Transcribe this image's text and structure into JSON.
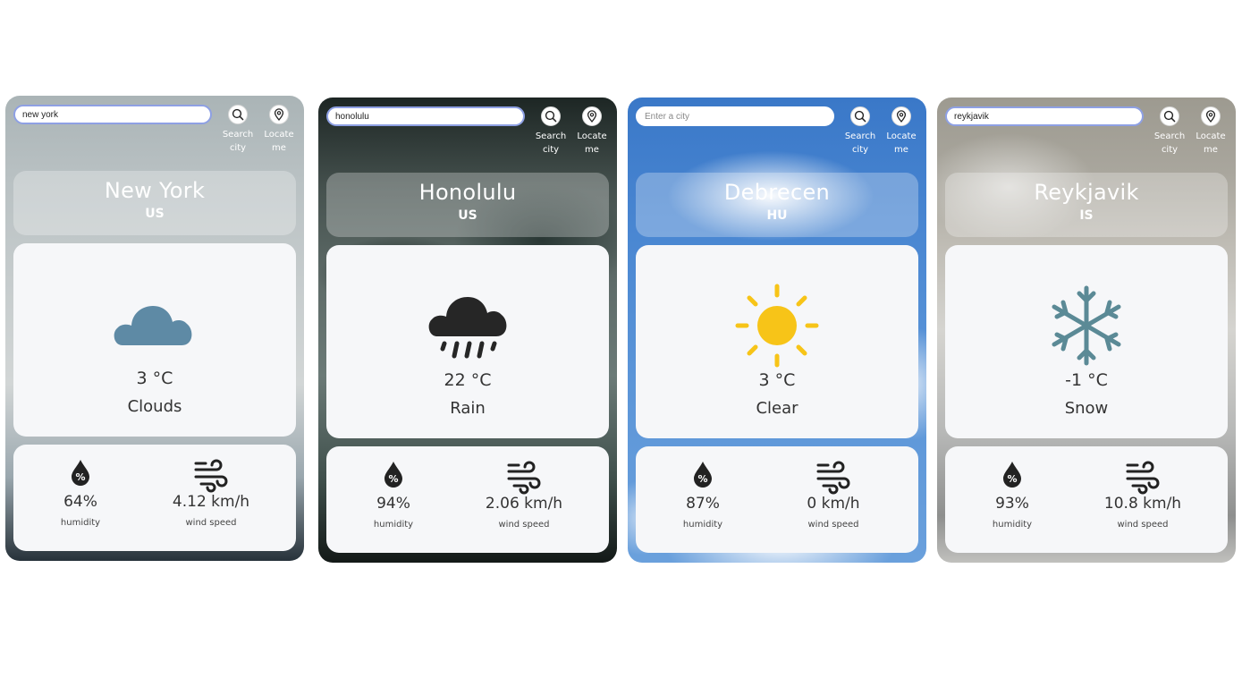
{
  "search_button_label": "Search city",
  "locate_button_label": "Locate me",
  "humidity_caption": "humidity",
  "wind_caption": "wind speed",
  "colors": {
    "cloud": "#5e8aa5",
    "rain": "#262626",
    "sun": "#f7c418",
    "snow": "#5b8a96",
    "input_border": "#8ea0e4"
  },
  "cards": [
    {
      "search_value": "new york",
      "search_placeholder": "",
      "city": "New York",
      "country": "US",
      "temperature": "3 °C",
      "condition": "Clouds",
      "icon": "cloud-icon",
      "humidity": "64%",
      "wind_speed": "4.12 km/h"
    },
    {
      "search_value": "honolulu",
      "search_placeholder": "",
      "city": "Honolulu",
      "country": "US",
      "temperature": "22 °C",
      "condition": "Rain",
      "icon": "rain-icon",
      "humidity": "94%",
      "wind_speed": "2.06 km/h"
    },
    {
      "search_value": "",
      "search_placeholder": "Enter a city",
      "city": "Debrecen",
      "country": "HU",
      "temperature": "3 °C",
      "condition": "Clear",
      "icon": "sun-icon",
      "humidity": "87%",
      "wind_speed": "0 km/h"
    },
    {
      "search_value": "reykjavik",
      "search_placeholder": "",
      "city": "Reykjavik",
      "country": "IS",
      "temperature": "-1 °C",
      "condition": "Snow",
      "icon": "snowflake-icon",
      "humidity": "93%",
      "wind_speed": "10.8 km/h"
    }
  ]
}
